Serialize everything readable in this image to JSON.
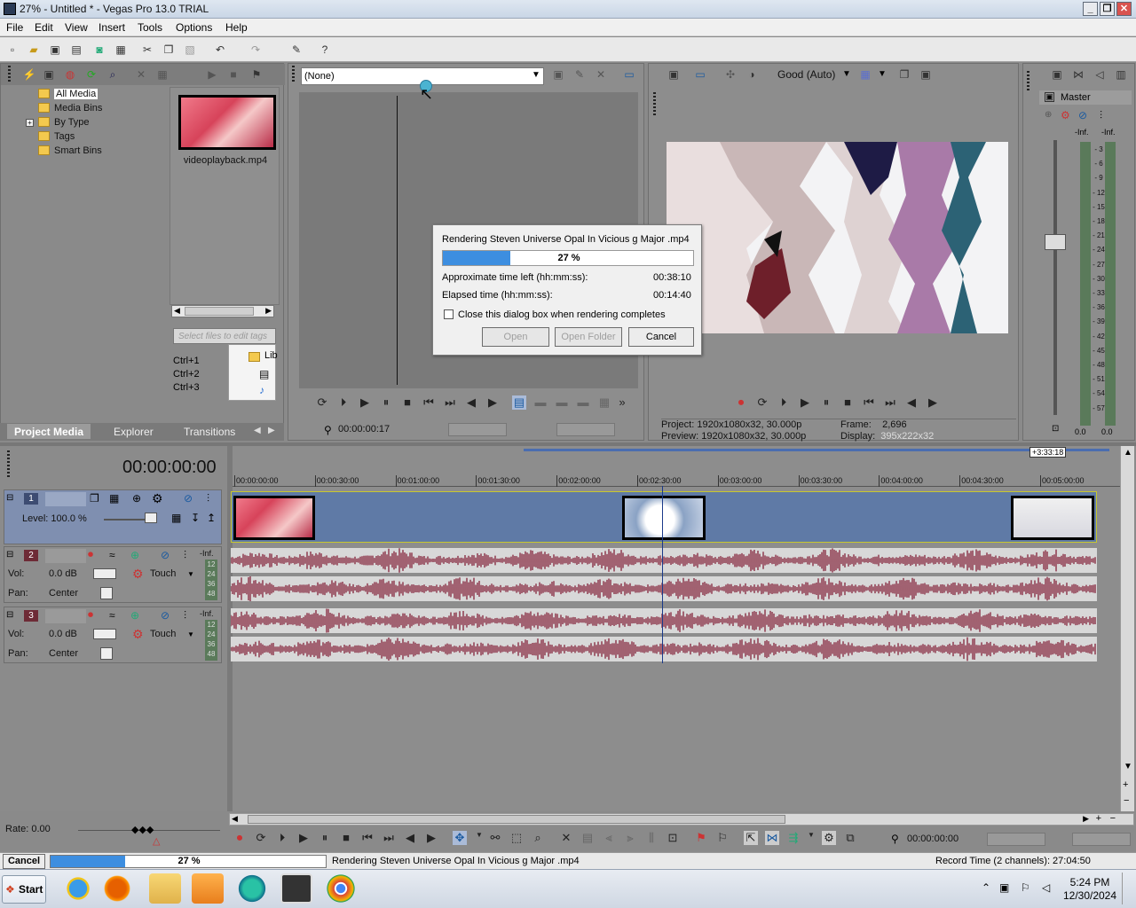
{
  "window": {
    "title": "27% - Untitled * - Vegas Pro 13.0 TRIAL",
    "buttons": [
      "_",
      "❐",
      "✕"
    ]
  },
  "menu": [
    "File",
    "Edit",
    "View",
    "Insert",
    "Tools",
    "Options",
    "Help"
  ],
  "project_media": {
    "tree": [
      "All Media",
      "Media Bins",
      "By Type",
      "Tags",
      "Smart Bins"
    ],
    "file": "videoplayback.mp4",
    "search_placeholder": "Select files to edit tags",
    "shortcuts": [
      "Ctrl+1",
      "Ctrl+2",
      "Ctrl+3"
    ],
    "side_label": "Lib"
  },
  "tabs": [
    "Project Media",
    "Explorer",
    "Transitions"
  ],
  "trimmer": {
    "dropdown": "(None)",
    "timecode": "00:00:00:17"
  },
  "preview": {
    "quality": "Good (Auto)",
    "project_label": "Project:",
    "project_value": "1920x1080x32, 30.000p",
    "preview_label": "Preview:",
    "preview_value": "1920x1080x32, 30.000p",
    "frame_label": "Frame:",
    "frame_value": "2,696",
    "display_label": "Display:",
    "display_value": "395x222x32"
  },
  "mixer": {
    "title": "Master",
    "inf": [
      "-Inf.",
      "-Inf."
    ],
    "scale": [
      "3",
      "6",
      "9",
      "12",
      "15",
      "18",
      "21",
      "24",
      "27",
      "30",
      "33",
      "36",
      "39",
      "42",
      "45",
      "48",
      "51",
      "54",
      "57"
    ],
    "bottom": [
      "0.0",
      "0.0"
    ]
  },
  "render_dialog": {
    "title": "Rendering Steven Universe Opal In Vicious g Major .mp4",
    "progress": 0.27,
    "progress_text": "27 %",
    "time_left_label": "Approximate time left (hh:mm:ss):",
    "time_left": "00:38:10",
    "elapsed_label": "Elapsed time (hh:mm:ss):",
    "elapsed": "00:14:40",
    "checkbox_label": "Close this dialog box when rendering completes",
    "open": "Open",
    "open_folder": "Open Folder",
    "cancel": "Cancel"
  },
  "timeline": {
    "timecode": "00:00:00:00",
    "end_marker": "+3:33:18",
    "ruler": [
      "00:00:00:00",
      "00:00:30:00",
      "00:01:00:00",
      "00:01:30:00",
      "00:02:00:00",
      "00:02:30:00",
      "00:03:00:00",
      "00:03:30:00",
      "00:04:00:00",
      "00:04:30:00",
      "00:05:00:00"
    ],
    "tracks": [
      {
        "num": "1",
        "level": "Level: 100.0 %"
      },
      {
        "num": "2",
        "vol_label": "Vol:",
        "vol": "0.0 dB",
        "pan_label": "Pan:",
        "pan": "Center",
        "mode": "Touch",
        "inf": "-Inf.",
        "meter": [
          "12",
          "24",
          "36",
          "48"
        ]
      },
      {
        "num": "3",
        "vol_label": "Vol:",
        "vol": "0.0 dB",
        "pan_label": "Pan:",
        "pan": "Center",
        "mode": "Touch",
        "inf": "-Inf.",
        "meter": [
          "12",
          "24",
          "36",
          "48"
        ]
      }
    ],
    "rate": "Rate: 0.00",
    "bottom_timecode": "00:00:00:00"
  },
  "status": {
    "cancel": "Cancel",
    "progress": 0.27,
    "progress_text": "27 %",
    "message": "Rendering Steven Universe Opal In Vicious g Major .mp4",
    "record_time": "Record Time (2 channels): 27:04:50"
  },
  "taskbar": {
    "start": "Start",
    "time": "5:24 PM",
    "date": "12/30/2024"
  }
}
